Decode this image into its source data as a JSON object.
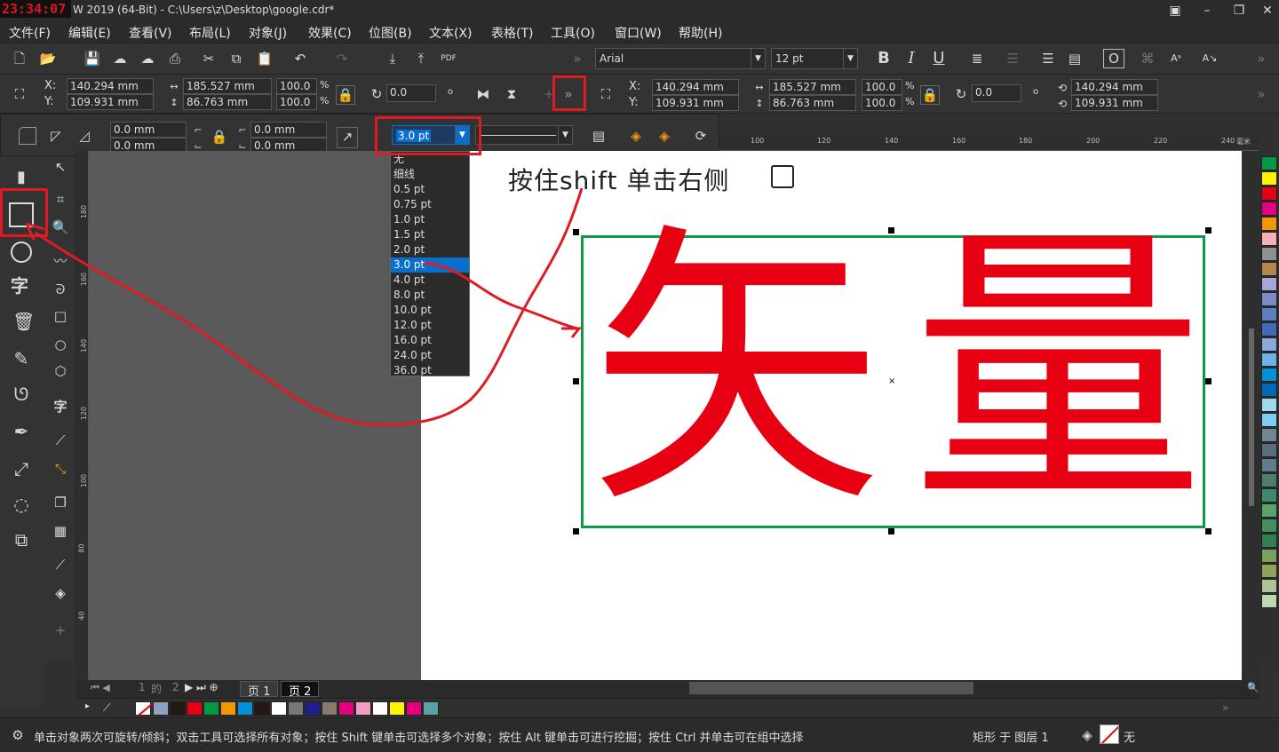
{
  "clock": "23:34:07",
  "window_title": "W 2019 (64-Bit) - C:\\Users\\z\\Desktop\\google.cdr*",
  "menu": [
    "文件(F)",
    "编辑(E)",
    "查看(V)",
    "布局(L)",
    "对象(J)",
    "效果(C)",
    "位图(B)",
    "文本(X)",
    "表格(T)",
    "工具(O)",
    "窗口(W)",
    "帮助(H)"
  ],
  "font_name": "Arial",
  "font_size": "12 pt",
  "props": {
    "x": "140.294 mm",
    "y": "109.931 mm",
    "w": "185.527 mm",
    "h": "86.763 mm",
    "sx": "100.0",
    "sy": "100.0",
    "pct": "%",
    "rot": "0.0",
    "x_label": "X:",
    "y_label": "Y:"
  },
  "props2": {
    "x": "140.294 mm",
    "y": "109.931 mm",
    "w": "185.527 mm",
    "h": "86.763 mm",
    "sx": "100.0",
    "sy": "100.0",
    "rot": "0.0",
    "rx": "140.294 mm",
    "ry": "109.931 mm"
  },
  "corners": {
    "a": "0.0 mm",
    "b": "0.0 mm",
    "c": "0.0 mm",
    "d": "0.0 mm"
  },
  "outline_width": "3.0 pt",
  "outline_options": [
    "无",
    "细线",
    "0.5 pt",
    "0.75 pt",
    "1.0 pt",
    "1.5 pt",
    "2.0 pt",
    "3.0 pt",
    "4.0 pt",
    "8.0 pt",
    "10.0 pt",
    "12.0 pt",
    "16.0 pt",
    "24.0 pt",
    "36.0 pt"
  ],
  "ruler_top": [
    "100",
    "120",
    "140",
    "160",
    "180",
    "200",
    "220",
    "240"
  ],
  "ruler_left": [
    "180",
    "160",
    "140",
    "120",
    "100",
    "80",
    "60",
    "40"
  ],
  "ruler_unit": "毫米",
  "canvas_note": "按住shift 单击右侧",
  "big_text": [
    "矢",
    "量"
  ],
  "pages": {
    "info_a": "1",
    "of": "的",
    "info_b": "2",
    "tab1": "页 1",
    "tab2": "页 2"
  },
  "status_text": "单击对象两次可旋转/倾斜；双击工具可选择所有对象；按住 Shift 键单击可选择多个对象；按住 Alt 键单击可进行挖掘；按住 Ctrl 并单击可在组中选择",
  "status_layer": "矩形 于 图层 1",
  "status_fill": "无",
  "palette": [
    "#009944",
    "#fff100",
    "#e60012",
    "#e4007f",
    "#f39800",
    "#f5b2b2",
    "#8f8f8f",
    "#b28850",
    "#a5a8d6",
    "#7b8dc8",
    "#5d7fc0",
    "#3e6ab8",
    "#88abda",
    "#6db3e5",
    "#0092d8",
    "#0068b7",
    "#a0d8ef",
    "#7ecef4",
    "#6f8795",
    "#5a6e7a",
    "#607d8b",
    "#4f7d6e",
    "#3d8b6a",
    "#5aa469",
    "#409060",
    "#2e8050",
    "#7ba05b",
    "#8fa35c",
    "#adc49a",
    "#c0d8b0"
  ],
  "docpal": [
    "#8fa0c0",
    "#231815",
    "#e60012",
    "#009944",
    "#f39800",
    "#0092d8",
    "#231815",
    "#ffffff",
    "#777777",
    "#1d2088",
    "#8a7a6a",
    "#e4007f",
    "#f19ec2",
    "#ffffff",
    "#fff100",
    "#e4007f",
    "#5aa2a8"
  ]
}
